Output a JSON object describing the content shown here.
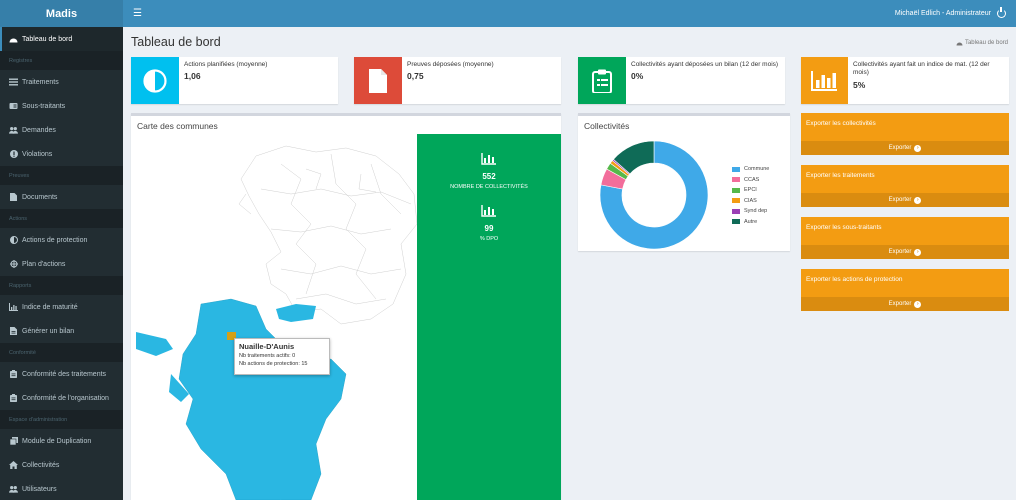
{
  "app": {
    "name": "Madis"
  },
  "topbar": {
    "user": "Michaël Edlich - Administrateur"
  },
  "sidebar": {
    "items": [
      {
        "label": "Tableau de bord",
        "icon": "dashboard-icon",
        "active": true
      },
      {
        "header": "Registres"
      },
      {
        "label": "Traitements",
        "icon": "list-icon"
      },
      {
        "label": "Sous-traitants",
        "icon": "id-card-icon"
      },
      {
        "label": "Demandes",
        "icon": "users-icon"
      },
      {
        "label": "Violations",
        "icon": "alert-icon"
      },
      {
        "header": "Preuves"
      },
      {
        "label": "Documents",
        "icon": "document-icon"
      },
      {
        "header": "Actions"
      },
      {
        "label": "Actions de protection",
        "icon": "half-circle-icon"
      },
      {
        "label": "Plan d'actions",
        "icon": "crosshair-icon"
      },
      {
        "header": "Rapports"
      },
      {
        "label": "Indice de maturité",
        "icon": "bar-chart-icon"
      },
      {
        "label": "Générer un bilan",
        "icon": "file-icon"
      },
      {
        "header": "Conformité"
      },
      {
        "label": "Conformité des traitements",
        "icon": "clipboard-icon"
      },
      {
        "label": "Conformité de l'organisation",
        "icon": "clipboard-icon"
      },
      {
        "header": "Espace d'administration"
      },
      {
        "label": "Module de Duplication",
        "icon": "copy-icon"
      },
      {
        "label": "Collectivités",
        "icon": "home-icon"
      },
      {
        "label": "Utilisateurs",
        "icon": "users-icon"
      }
    ]
  },
  "page": {
    "title": "Tableau de bord",
    "breadcrumb": "Tableau de bord"
  },
  "infoboxes": [
    {
      "label": "Actions planifiées (moyenne)",
      "value": "1,06",
      "color": "#00c0ef",
      "icon": "half-circle-icon"
    },
    {
      "label": "Preuves déposées (moyenne)",
      "value": "0,75",
      "color": "#dd4b39",
      "icon": "document-icon"
    },
    {
      "label": "Collectivités ayant déposées un bilan (12 der mois)",
      "value": "0%",
      "color": "#00a65a",
      "icon": "clipboard-icon"
    },
    {
      "label": "Collectivités ayant fait un indice de mat. (12 der mois)",
      "value": "5%",
      "color": "#f39c12",
      "icon": "bar-chart-icon"
    }
  ],
  "map": {
    "title": "Carte des communes",
    "stats": [
      {
        "value": "552",
        "caption": "NOMBRE DE COLLECTIVITÉS"
      },
      {
        "value": "99",
        "caption": "% DPO"
      }
    ],
    "tooltip": {
      "title": "Nuaille-D'Aunis",
      "line1": "Nb traitements actifs: 0",
      "line2": "Nb actions de protection: 15"
    }
  },
  "collectivites": {
    "title": "Collectivités",
    "colors": [
      "#3fa9e8",
      "#f26d9b",
      "#55b84a",
      "#f39c12",
      "#9b3fb5",
      "#0f6b57"
    ],
    "chart_data": {
      "type": "pie",
      "categories": [
        "Commune",
        "CCAS",
        "EPCI",
        "CIAS",
        "Synd dep",
        "Autre"
      ],
      "values": [
        78,
        5,
        2,
        1,
        0.5,
        13.5
      ]
    }
  },
  "exports": [
    {
      "title": "Exporter les collectivités",
      "button": "Exporter"
    },
    {
      "title": "Exporter les traitements",
      "button": "Exporter"
    },
    {
      "title": "Exporter les sous-traitants",
      "button": "Exporter"
    },
    {
      "title": "Exporter les actions de protection",
      "button": "Exporter"
    }
  ]
}
